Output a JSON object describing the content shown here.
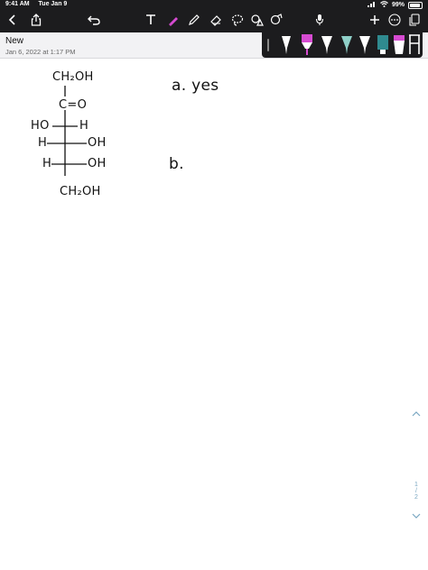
{
  "status": {
    "time": "9:41 AM",
    "date": "Tue Jan 9",
    "battery": "99%"
  },
  "toolbar": {
    "icons": [
      "back-chevron-icon",
      "share-icon",
      "undo-icon",
      "text-tool-icon",
      "highlighter-icon",
      "pencil-icon",
      "eraser-icon",
      "lasso-icon",
      "shapes-icon",
      "image-icon",
      "microphone-icon",
      "add-icon",
      "more-icon",
      "pages-icon"
    ]
  },
  "note": {
    "title": "New",
    "date": "Jan 6, 2022 at 1:17 PM"
  },
  "pens": {
    "colors": [
      "#ffffff",
      "#d64bd1",
      "#ffffff",
      "#8fd0c8",
      "#ffffff",
      "#2f8a8f",
      "#d64bd1",
      "#ffffff"
    ]
  },
  "handwriting": {
    "ch2oh_top": "CH₂OH",
    "carbonyl": "C=O",
    "row1_left": "HO",
    "row1_right": "H",
    "row2_left": "H",
    "row2_right": "OH",
    "row3_left": "H",
    "row3_right": "OH",
    "ch2oh_bottom": "CH₂OH",
    "answer_a": "a. yes",
    "answer_b": "b."
  },
  "pager": {
    "current": "1",
    "separator": "/",
    "total": "2"
  },
  "colors": {
    "toolbar_bg": "#1c1c1e",
    "accent": "#d64bd1",
    "pager": "#7aa7c2"
  }
}
